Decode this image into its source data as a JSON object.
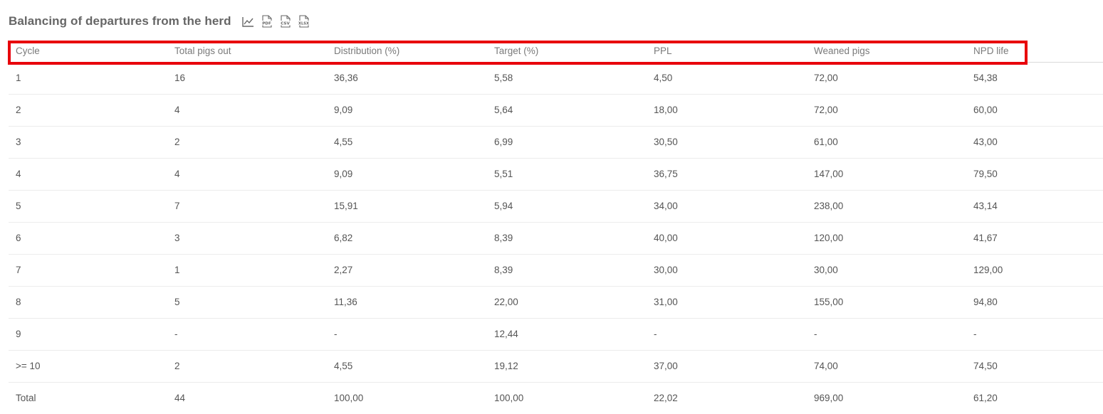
{
  "title": "Balancing of departures from the herd",
  "toolbar": {
    "chart_icon": "line-chart-icon",
    "pdf_label": "PDF",
    "csv_label": "CSV",
    "xlsx_label": "XLSX"
  },
  "colors": {
    "highlight": "#e8000b",
    "title": "#666666",
    "text": "#555555"
  },
  "table": {
    "headers": [
      "Cycle",
      "Total pigs out",
      "Distribution (%)",
      "Target (%)",
      "PPL",
      "Weaned pigs",
      "NPD life"
    ],
    "rows": [
      [
        "1",
        "16",
        "36,36",
        "5,58",
        "4,50",
        "72,00",
        "54,38"
      ],
      [
        "2",
        "4",
        "9,09",
        "5,64",
        "18,00",
        "72,00",
        "60,00"
      ],
      [
        "3",
        "2",
        "4,55",
        "6,99",
        "30,50",
        "61,00",
        "43,00"
      ],
      [
        "4",
        "4",
        "9,09",
        "5,51",
        "36,75",
        "147,00",
        "79,50"
      ],
      [
        "5",
        "7",
        "15,91",
        "5,94",
        "34,00",
        "238,00",
        "43,14"
      ],
      [
        "6",
        "3",
        "6,82",
        "8,39",
        "40,00",
        "120,00",
        "41,67"
      ],
      [
        "7",
        "1",
        "2,27",
        "8,39",
        "30,00",
        "30,00",
        "129,00"
      ],
      [
        "8",
        "5",
        "11,36",
        "22,00",
        "31,00",
        "155,00",
        "94,80"
      ],
      [
        "9",
        "-",
        "-",
        "12,44",
        "-",
        "-",
        "-"
      ],
      [
        ">= 10",
        "2",
        "4,55",
        "19,12",
        "37,00",
        "74,00",
        "74,50"
      ],
      [
        "Total",
        "44",
        "100,00",
        "100,00",
        "22,02",
        "969,00",
        "61,20"
      ]
    ]
  }
}
